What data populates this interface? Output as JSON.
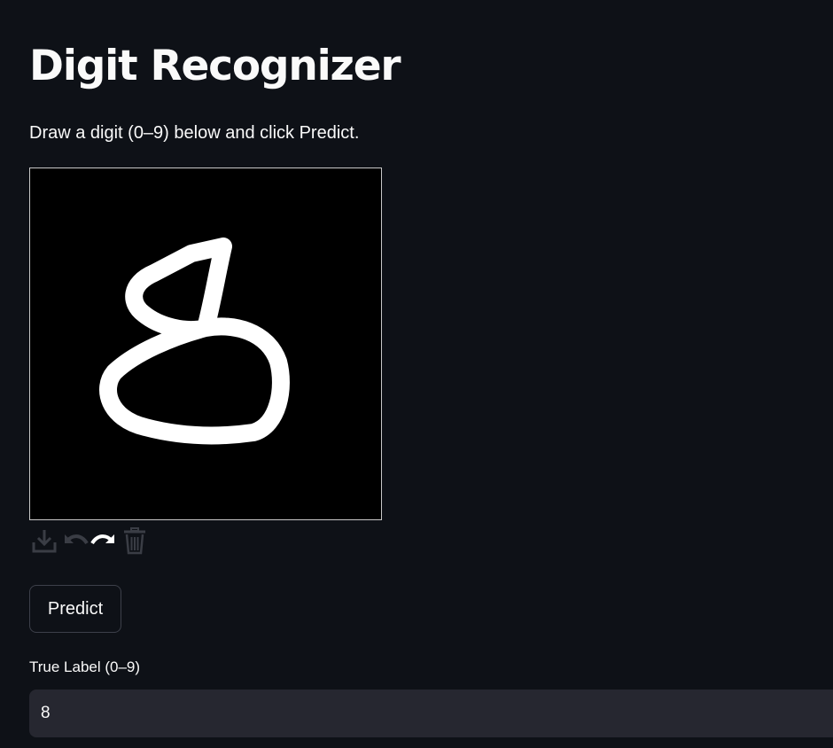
{
  "page": {
    "title": "Digit Recognizer",
    "subtitle": "Draw a digit (0–9) below and click Predict."
  },
  "canvas": {
    "background": "#000000",
    "stroke_color": "#ffffff",
    "drawn_digit": "8"
  },
  "toolbar": {
    "icons": [
      "download-icon",
      "undo-icon",
      "redo-icon",
      "trash-icon"
    ]
  },
  "predict_button": {
    "label": "Predict"
  },
  "true_label_field": {
    "label": "True Label (0–9)",
    "value": "8"
  },
  "colors": {
    "background": "#0e1117",
    "text": "#fafafa",
    "input_background": "#262730",
    "button_border": "#3d404a",
    "icon_gray": "#3a3d45"
  }
}
